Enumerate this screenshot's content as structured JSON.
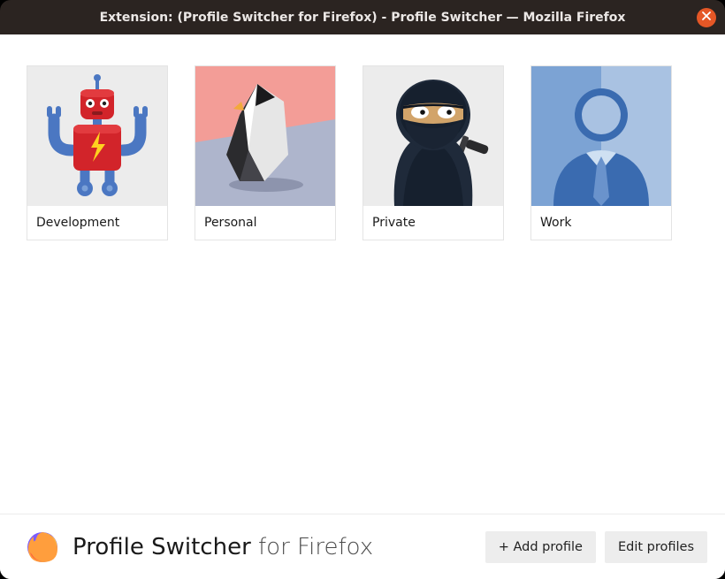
{
  "window": {
    "title": "Extension: (Profile Switcher for Firefox) - Profile Switcher — Mozilla Firefox"
  },
  "profiles": [
    {
      "label": "Development",
      "icon": "robot"
    },
    {
      "label": "Personal",
      "icon": "penguin"
    },
    {
      "label": "Private",
      "icon": "ninja"
    },
    {
      "label": "Work",
      "icon": "businessman"
    }
  ],
  "footer": {
    "title_main": "Profile Switcher",
    "title_sub": " for Firefox",
    "add_label": "+ Add profile",
    "edit_label": "Edit profiles"
  }
}
